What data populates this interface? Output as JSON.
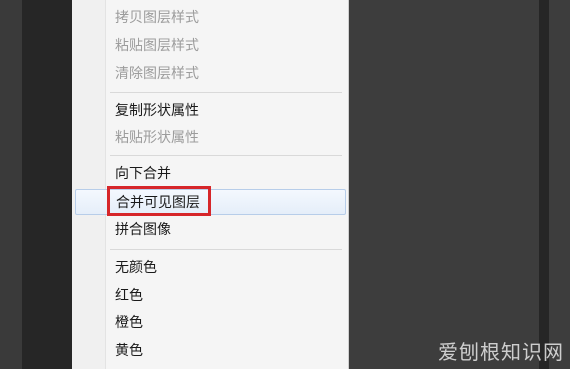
{
  "menu": {
    "items": [
      {
        "label": "拷贝图层样式",
        "disabled": true
      },
      {
        "label": "粘贴图层样式",
        "disabled": true
      },
      {
        "label": "清除图层样式",
        "disabled": true
      },
      {
        "label": "复制形状属性",
        "disabled": false
      },
      {
        "label": "粘贴形状属性",
        "disabled": true
      },
      {
        "label": "向下合并",
        "disabled": false
      },
      {
        "label": "合并可见图层",
        "disabled": false,
        "highlighted": true
      },
      {
        "label": "拼合图像",
        "disabled": false
      },
      {
        "label": "无颜色",
        "disabled": false
      },
      {
        "label": "红色",
        "disabled": false
      },
      {
        "label": "橙色",
        "disabled": false
      },
      {
        "label": "黄色",
        "disabled": false
      }
    ]
  },
  "watermark": "爱刨根知识网",
  "colors": {
    "highlight_box": "#d6262a",
    "disabled_text": "#9c9c9c",
    "menu_background": "#f5f5f5"
  }
}
